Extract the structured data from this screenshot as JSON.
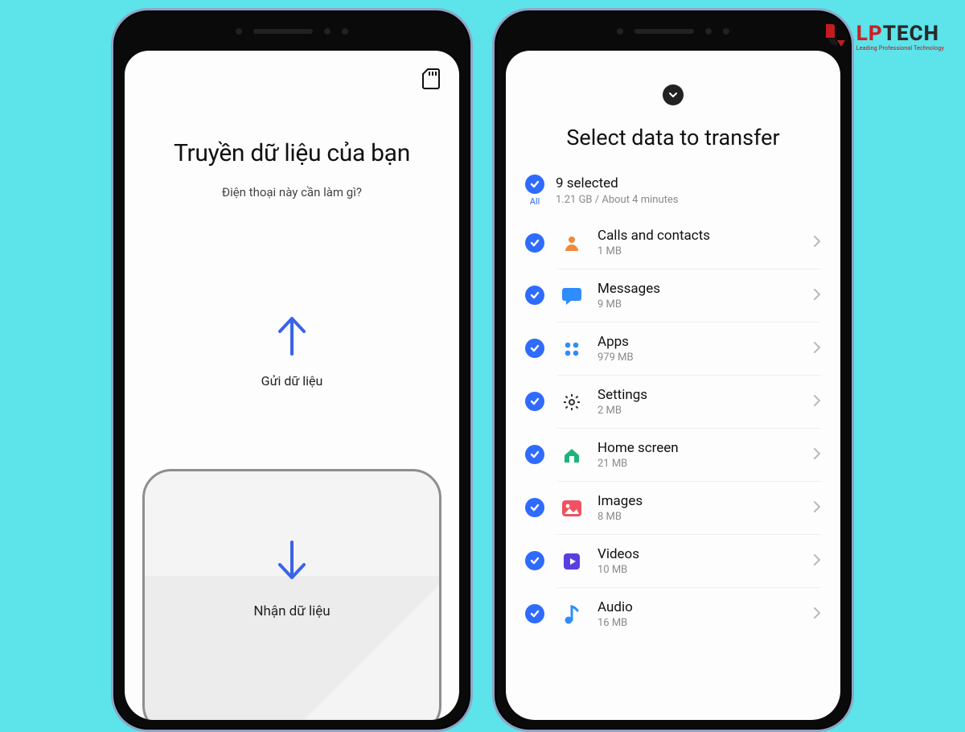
{
  "logo": {
    "name": "LPTECH",
    "tagline": "Leading Professional Technology"
  },
  "phone1": {
    "title": "Truyền dữ liệu của bạn",
    "subtitle": "Điện thoại này cần làm gì?",
    "send_label": "Gửi dữ liệu",
    "receive_label": "Nhận dữ liệu"
  },
  "phone2": {
    "title": "Select data to transfer",
    "all_label": "All",
    "selected_summary_title": "9 selected",
    "selected_summary_sub": "1.21 GB / About 4 minutes",
    "items": [
      {
        "label": "Calls and contacts",
        "size": "1 MB",
        "icon": "contact"
      },
      {
        "label": "Messages",
        "size": "9 MB",
        "icon": "message"
      },
      {
        "label": "Apps",
        "size": "979 MB",
        "icon": "apps"
      },
      {
        "label": "Settings",
        "size": "2 MB",
        "icon": "settings"
      },
      {
        "label": "Home screen",
        "size": "21 MB",
        "icon": "home"
      },
      {
        "label": "Images",
        "size": "8 MB",
        "icon": "images"
      },
      {
        "label": "Videos",
        "size": "10 MB",
        "icon": "videos"
      },
      {
        "label": "Audio",
        "size": "16 MB",
        "icon": "audio"
      }
    ]
  },
  "colors": {
    "accent": "#2f6bff",
    "arrow": "#3a63e8"
  }
}
